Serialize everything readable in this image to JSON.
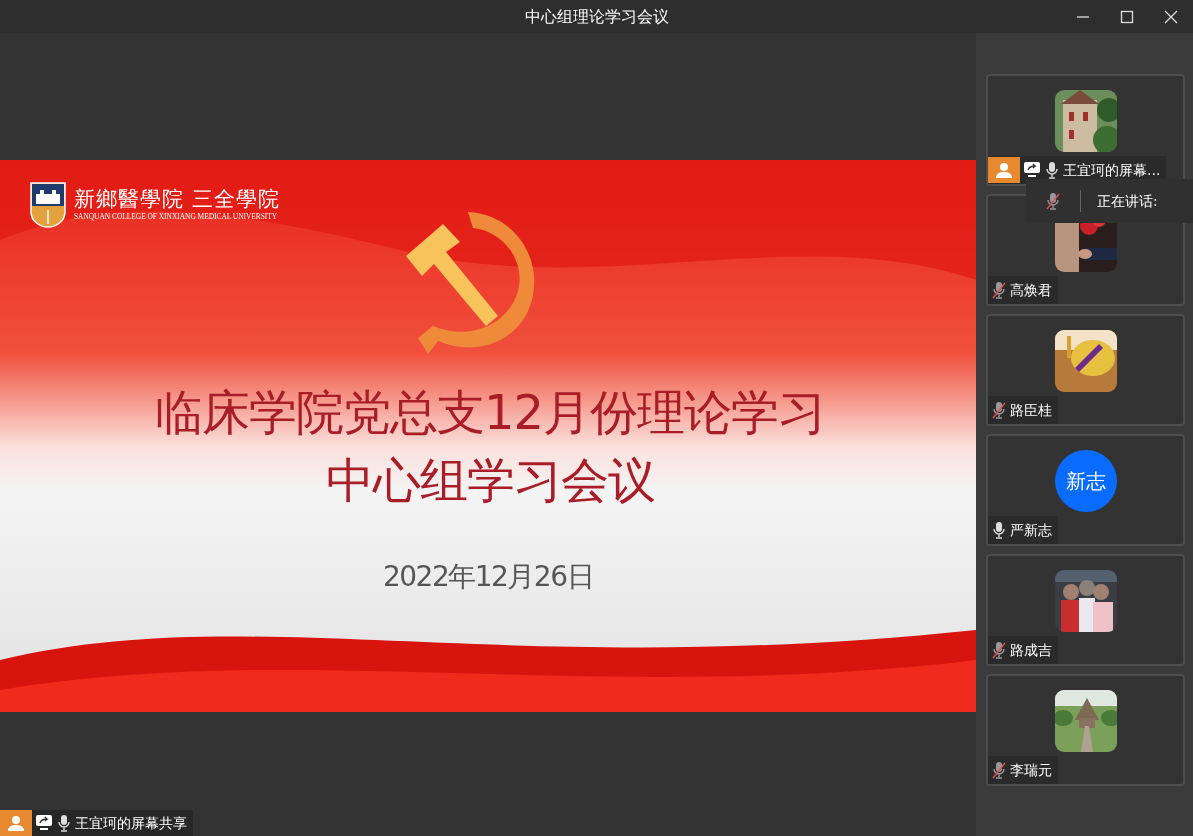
{
  "window": {
    "title": "中心组理论学习会议"
  },
  "slide": {
    "logo_text": "新鄉醫學院 三全學院",
    "logo_subtitle": "SANQUAN COLLEGE OF XINXIANG MEDICAL UNIVERSITY",
    "title_lines": [
      "临床学院党总支12月份理论学习",
      "中心组学习会议"
    ],
    "date": "2022年12月26日"
  },
  "share_label": {
    "host": true,
    "sharing": true,
    "muted": false,
    "text": "王宜珂的屏幕共享"
  },
  "participants": [
    {
      "name": "王宜珂的屏幕...",
      "host": true,
      "sharing": true,
      "muted": false
    },
    {
      "name": "高焕君",
      "host": false,
      "sharing": false,
      "muted": true
    },
    {
      "name": "路臣桂",
      "host": false,
      "sharing": false,
      "muted": true
    },
    {
      "name": "严新志",
      "host": false,
      "sharing": false,
      "muted": false,
      "avatar": {
        "kind": "initials",
        "text": "新志"
      }
    },
    {
      "name": "路成吉",
      "host": false,
      "sharing": false,
      "muted": true
    },
    {
      "name": "李瑞元",
      "host": false,
      "sharing": false,
      "muted": true
    }
  ],
  "speaking_tooltip": {
    "label": "正在讲话:",
    "muted": true
  }
}
